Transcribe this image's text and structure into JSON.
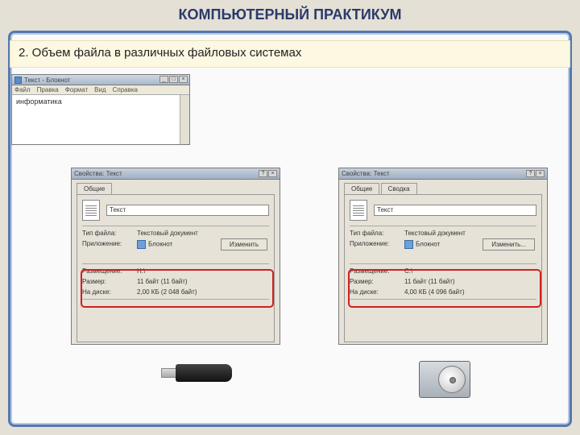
{
  "title": "КОМПЬЮТЕРНЫЙ ПРАКТИКУМ",
  "section": "2. Объем файла в различных файловых системах",
  "notepad": {
    "title": "Текст - Блокнот",
    "menu": {
      "file": "Файл",
      "edit": "Правка",
      "format": "Формат",
      "view": "Вид",
      "help": "Справка"
    },
    "content": "информатика"
  },
  "propsLeft": {
    "title": "Свойства: Текст",
    "tabs": {
      "general": "Общие"
    },
    "filename": "Текст",
    "rows": {
      "typeLabel": "Тип файла:",
      "typeValue": "Текстовый документ",
      "appLabel": "Приложение:",
      "appValue": "Блокнот",
      "changeBtn": "Изменить",
      "locLabel": "Размещение:",
      "locValue": "H:\\",
      "sizeLabel": "Размер:",
      "sizeValue": "11 байт (11 байт)",
      "diskLabel": "На диске:",
      "diskValue": "2,00 КБ (2 048 байт)"
    }
  },
  "propsRight": {
    "title": "Свойства: Текст",
    "tabs": {
      "general": "Общие",
      "summary": "Сводка"
    },
    "filename": "Текст",
    "rows": {
      "typeLabel": "Тип файла:",
      "typeValue": "Текстовый документ",
      "appLabel": "Приложение:",
      "appValue": "Блокнот",
      "changeBtn": "Изменить...",
      "locLabel": "Размещение:",
      "locValue": "C:\\",
      "sizeLabel": "Размер:",
      "sizeValue": "11 байт (11 байт)",
      "diskLabel": "На диске:",
      "diskValue": "4,00 КБ (4 096 байт)"
    }
  }
}
